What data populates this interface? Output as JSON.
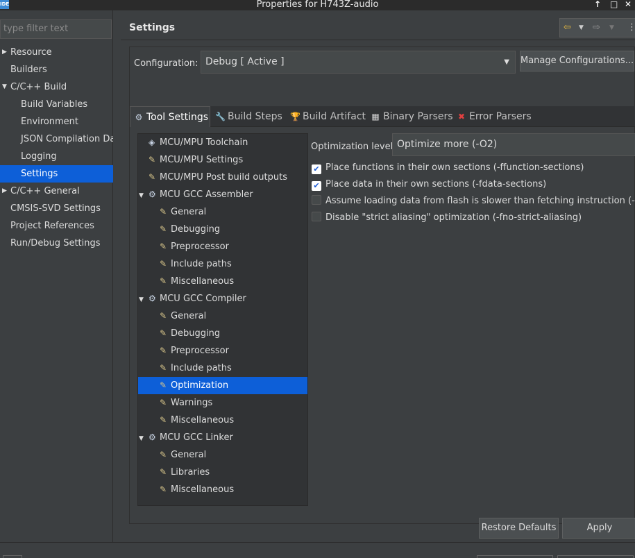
{
  "window": {
    "title": "Properties for H743Z-audio",
    "app_icon": "IDE"
  },
  "filter": {
    "placeholder": "type filter text"
  },
  "nav": [
    {
      "label": "Resource",
      "level": 0,
      "expander": "collapsed"
    },
    {
      "label": "Builders",
      "level": 0
    },
    {
      "label": "C/C++ Build",
      "level": 0,
      "expander": "expanded"
    },
    {
      "label": "Build Variables",
      "level": 1
    },
    {
      "label": "Environment",
      "level": 1
    },
    {
      "label": "JSON Compilation Dat",
      "level": 1
    },
    {
      "label": "Logging",
      "level": 1
    },
    {
      "label": "Settings",
      "level": 1,
      "selected": true
    },
    {
      "label": "C/C++ General",
      "level": 0,
      "expander": "collapsed"
    },
    {
      "label": "CMSIS-SVD Settings",
      "level": 0
    },
    {
      "label": "Project References",
      "level": 0
    },
    {
      "label": "Run/Debug Settings",
      "level": 0
    }
  ],
  "header": {
    "title": "Settings"
  },
  "config": {
    "label": "Configuration:",
    "value": "Debug  [ Active ]",
    "manage_button": "Manage Configurations..."
  },
  "tabs": [
    {
      "label": "Tool Settings",
      "icon": "gear-icon",
      "active": true
    },
    {
      "label": "Build Steps",
      "icon": "wrench-icon"
    },
    {
      "label": "Build Artifact",
      "icon": "trophy-icon"
    },
    {
      "label": "Binary Parsers",
      "icon": "binary-icon"
    },
    {
      "label": "Error Parsers",
      "icon": "error-icon"
    }
  ],
  "tool_tree": [
    {
      "label": "MCU/MPU Toolchain",
      "level": 0,
      "icon": "chip-icon"
    },
    {
      "label": "MCU/MPU Settings",
      "level": 0,
      "icon": "settings-page-icon"
    },
    {
      "label": "MCU/MPU Post build outputs",
      "level": 0,
      "icon": "settings-page-icon"
    },
    {
      "label": "MCU GCC Assembler",
      "level": 0,
      "icon": "gear-icon",
      "expander": "expanded"
    },
    {
      "label": "General",
      "level": 1,
      "icon": "settings-page-icon"
    },
    {
      "label": "Debugging",
      "level": 1,
      "icon": "settings-page-icon"
    },
    {
      "label": "Preprocessor",
      "level": 1,
      "icon": "settings-page-icon"
    },
    {
      "label": "Include paths",
      "level": 1,
      "icon": "settings-page-icon"
    },
    {
      "label": "Miscellaneous",
      "level": 1,
      "icon": "settings-page-icon"
    },
    {
      "label": "MCU GCC Compiler",
      "level": 0,
      "icon": "gear-icon",
      "expander": "expanded"
    },
    {
      "label": "General",
      "level": 1,
      "icon": "settings-page-icon"
    },
    {
      "label": "Debugging",
      "level": 1,
      "icon": "settings-page-icon"
    },
    {
      "label": "Preprocessor",
      "level": 1,
      "icon": "settings-page-icon"
    },
    {
      "label": "Include paths",
      "level": 1,
      "icon": "settings-page-icon"
    },
    {
      "label": "Optimization",
      "level": 1,
      "icon": "settings-page-icon",
      "selected": true
    },
    {
      "label": "Warnings",
      "level": 1,
      "icon": "settings-page-icon"
    },
    {
      "label": "Miscellaneous",
      "level": 1,
      "icon": "settings-page-icon"
    },
    {
      "label": "MCU GCC Linker",
      "level": 0,
      "icon": "gear-icon",
      "expander": "expanded"
    },
    {
      "label": "General",
      "level": 1,
      "icon": "settings-page-icon"
    },
    {
      "label": "Libraries",
      "level": 1,
      "icon": "settings-page-icon"
    },
    {
      "label": "Miscellaneous",
      "level": 1,
      "icon": "settings-page-icon"
    }
  ],
  "optimization": {
    "label": "Optimization level",
    "value": "Optimize more (-O2)",
    "options": [
      {
        "label": "Place functions in their own sections (-ffunction-sections)",
        "checked": true
      },
      {
        "label": "Place data in their own sections (-fdata-sections)",
        "checked": true
      },
      {
        "label": "Assume loading data from flash is slower than fetching instruction (-mslo",
        "checked": false
      },
      {
        "label": "Disable \"strict aliasing\" optimization (-fno-strict-aliasing)",
        "checked": false
      }
    ]
  },
  "buttons": {
    "restore": "Restore Defaults",
    "apply": "Apply"
  },
  "colors": {
    "selection": "#0d5fd8",
    "background": "#3c3f41",
    "tree_bg": "#313335"
  }
}
